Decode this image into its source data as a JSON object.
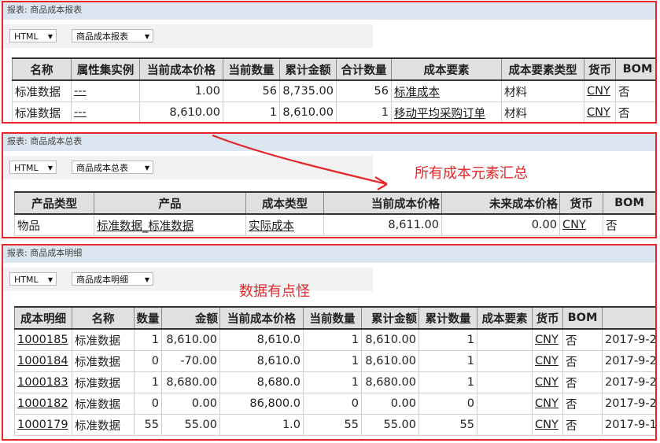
{
  "panel1": {
    "title": "报表: 商品成本报表",
    "format": "HTML",
    "report": "商品成本报表",
    "columns": [
      "名称",
      "属性集实例",
      "当前成本价格",
      "当前数量",
      "累计金额",
      "合计数量",
      "成本要素",
      "成本要素类型",
      "货币",
      "BOM"
    ],
    "rows": [
      [
        "标准数据",
        "---",
        "1.00",
        "56",
        "8,735.00",
        "56",
        "标准成本",
        "材料",
        "CNY",
        "否"
      ],
      [
        "标准数据",
        "---",
        "8,610.00",
        "1",
        "8,610.00",
        "1",
        "移动平均采购订单",
        "材料",
        "CNY",
        "否"
      ]
    ]
  },
  "panel2": {
    "title": "报表: 商品成本总表",
    "format": "HTML",
    "report": "商品成本总表",
    "columns": [
      "产品类型",
      "产品",
      "成本类型",
      "当前成本价格",
      "未来成本价格",
      "货币",
      "BOM"
    ],
    "rows": [
      [
        "物品",
        "标准数据_标准数据",
        "实际成本",
        "8,611.00",
        "0.00",
        "CNY",
        "否"
      ]
    ],
    "annotation": "所有成本元素汇总"
  },
  "panel3": {
    "title": "报表: 商品成本明细",
    "format": "HTML",
    "report": "商品成本明细",
    "annotation": "数据有点怪",
    "columns": [
      "成本明细",
      "名称",
      "数量",
      "金额",
      "当前成本价格",
      "当前数量",
      "累计金额",
      "累计数量",
      "成本要素",
      "货币",
      "BOM",
      ""
    ],
    "rows": [
      [
        "1000185",
        "标准数据",
        "1",
        "8,610.00",
        "8,610.0",
        "1",
        "8,610.00",
        "1",
        "",
        "CNY",
        "否",
        "2017-9-2"
      ],
      [
        "1000184",
        "标准数据",
        "0",
        "-70.00",
        "8,610.0",
        "1",
        "8,610.00",
        "1",
        "",
        "CNY",
        "否",
        "2017-9-2"
      ],
      [
        "1000183",
        "标准数据",
        "1",
        "8,680.00",
        "8,680.0",
        "1",
        "8,680.00",
        "1",
        "",
        "CNY",
        "否",
        "2017-9-2"
      ],
      [
        "1000182",
        "标准数据",
        "0",
        "0.00",
        "86,800.0",
        "0",
        "0.00",
        "0",
        "",
        "CNY",
        "否",
        "2017-9-2"
      ],
      [
        "1000179",
        "标准数据",
        "55",
        "55.00",
        "1.0",
        "55",
        "55.00",
        "55",
        "",
        "CNY",
        "否",
        "2017-9-1"
      ]
    ]
  },
  "colors": {
    "frame": "#e5262a",
    "title_bar": "#dce6f0",
    "header_bg": "#e0e0e0"
  }
}
